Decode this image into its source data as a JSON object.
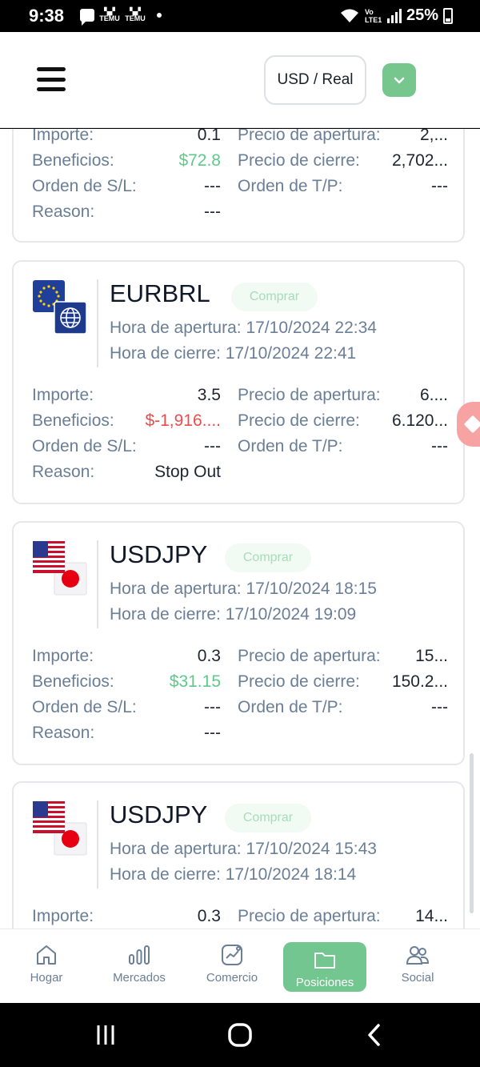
{
  "status_bar": {
    "time": "9:38",
    "notif_apps": [
      "TEMU",
      "TEMU"
    ],
    "volte": "Vo LTE1",
    "battery": "25%"
  },
  "header": {
    "account_label": "USD / Real",
    "accent_color": "#76c68e"
  },
  "labels": {
    "amount": "Importe:",
    "profit": "Beneficios:",
    "sl": "Orden de S/L:",
    "reason": "Reason:",
    "open_price": "Precio de apertura:",
    "close_price": "Precio de cierre:",
    "tp": "Orden de T/P:",
    "open_time": "Hora de apertura:",
    "close_time": "Hora de cierre:"
  },
  "partial_card": {
    "amount": "0.1",
    "profit": "$72.8",
    "sl": "---",
    "reason": "---",
    "open_price": "2,...",
    "close_price": "2,702...",
    "tp": "---"
  },
  "cards": [
    {
      "flag": "eu-globe-icon",
      "symbol": "EURBRL",
      "side": "Comprar",
      "open_time": "17/10/2024 22:34",
      "close_time": "17/10/2024 22:41",
      "amount": "3.5",
      "profit": "$-1,916....",
      "sl": "---",
      "reason": "Stop Out",
      "open_price": "6....",
      "close_price": "6.120...",
      "tp": "---"
    },
    {
      "flag": "us-jp-icon",
      "symbol": "USDJPY",
      "side": "Comprar",
      "open_time": "17/10/2024 18:15",
      "close_time": "17/10/2024 19:09",
      "amount": "0.3",
      "profit": "$31.15",
      "sl": "---",
      "reason": "---",
      "open_price": "15...",
      "close_price": "150.2...",
      "tp": "---"
    },
    {
      "flag": "us-jp-icon",
      "symbol": "USDJPY",
      "side": "Comprar",
      "open_time": "17/10/2024 15:43",
      "close_time": "17/10/2024 18:14",
      "amount": "0.3",
      "open_price": "14..."
    }
  ],
  "bottom_nav": [
    {
      "label": "Hogar",
      "icon": "home-icon"
    },
    {
      "label": "Mercados",
      "icon": "bars-icon"
    },
    {
      "label": "Comercio",
      "icon": "chart-icon"
    },
    {
      "label": "Posiciones",
      "icon": "folder-icon",
      "active": true
    },
    {
      "label": "Social",
      "icon": "people-icon"
    }
  ],
  "colors": {
    "positive": "#5fc98a",
    "negative": "#ee4b4b",
    "label": "#6a7e96"
  }
}
